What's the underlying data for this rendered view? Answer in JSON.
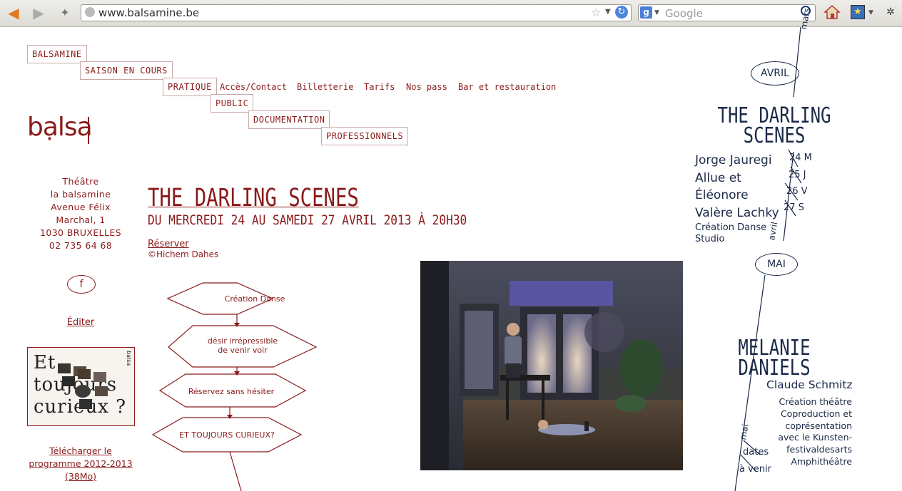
{
  "browser": {
    "url": "www.balsamine.be",
    "search_placeholder": "Google",
    "search_engine_letter": "g"
  },
  "nav": {
    "balsamine": "BALSAMINE",
    "saison": "SAISON EN COURS",
    "pratique": "PRATIQUE",
    "sub": [
      "Accès/Contact",
      "Billetterie",
      "Tarifs",
      "Nos pass",
      "Bar et restauration"
    ],
    "public": "PUBLIC",
    "documentation": "DOCUMENTATION",
    "professionnels": "PROFESSIONNELS"
  },
  "logo": "bạlsa",
  "address": [
    "Théâtre",
    "la balsamine",
    "Avenue Félix",
    "Marchal, 1",
    "1030 BRUXELLES",
    "02 735 64 68"
  ],
  "facebook": "f",
  "edit_link": "Éditer",
  "promo": {
    "lines": [
      "Et",
      "toujours",
      "curieux ?"
    ],
    "brand": "balsa"
  },
  "download": [
    "Télécharger le",
    "programme 2012-2013",
    "(38Mo)"
  ],
  "show": {
    "title": "THE DARLING SCENES",
    "dates": "DU MERCREDI 24 AU SAMEDI 27 AVRIL 2013 À 20H30",
    "reserve": "Réserver",
    "credit": "©Hichem Dahes"
  },
  "flowchart": [
    "Création Danse",
    "désir irrépressible",
    "de venir voir",
    "Réservez sans hésiter",
    "ET TOUJOURS CURIEUX?"
  ],
  "agenda": {
    "month_mars": "mars",
    "avril": "AVRIL",
    "show1_title": [
      "THE DARLING",
      "SCENES"
    ],
    "show1_people": [
      "Jorge Jauregi",
      "Allue et",
      "Éléonore",
      "Valère Lachky"
    ],
    "show1_dates": [
      "24 M",
      "25 J",
      "26 V",
      "27 S"
    ],
    "show1_type": [
      "Création Danse",
      "Studio"
    ],
    "month_avril": "avril",
    "mai": "MAI",
    "show2_title": [
      "MELANIE",
      "DANIELS"
    ],
    "show2_author": "Claude Schmitz",
    "show2_info": [
      "Création théâtre",
      "Coproduction et",
      "coprésentation",
      "avec le Kunsten-",
      "festivaldesarts",
      "Amphithéâtre"
    ],
    "month_mai": "mai",
    "dates_label": [
      "dates",
      "à venir"
    ]
  },
  "colors": {
    "accent": "#8b1a1a",
    "agenda": "#1b2a48"
  }
}
